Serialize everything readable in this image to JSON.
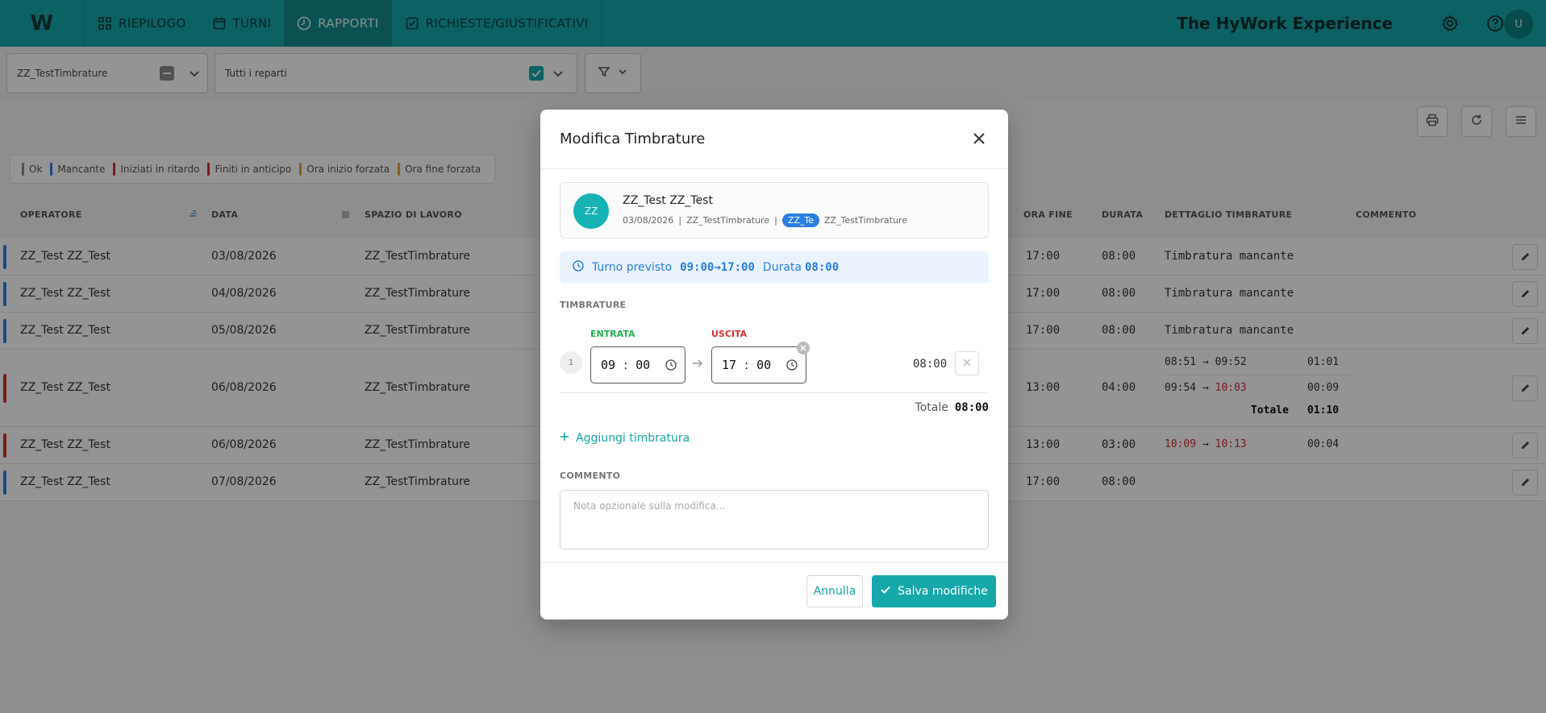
{
  "nav": {
    "logo": "W",
    "tabs": [
      {
        "label": "RIEPILOGO",
        "icon": "grid-icon"
      },
      {
        "label": "TURNI",
        "icon": "calendar-icon"
      },
      {
        "label": "RAPPORTI",
        "icon": "clock-icon",
        "active": true
      },
      {
        "label": "RICHIESTE/GIUSTIFICATIVI",
        "icon": "check-square-icon"
      }
    ],
    "brand": "The HyWork Experience",
    "user_initial": "U"
  },
  "filters": {
    "workspace": "ZZ_TestTimbrature",
    "department": "Tutti i reparti"
  },
  "legend": [
    "Ok",
    "Mancante",
    "Iniziati in ritardo",
    "Finiti in anticipo",
    "Ora inizio forzata",
    "Ora fine forzata"
  ],
  "legend_colors": [
    "#8a8d90",
    "#2a7de1",
    "#d62d2d",
    "#d62d2d",
    "#e6a23c",
    "#e6a23c"
  ],
  "table": {
    "headers": [
      "OPERATORE",
      "DATA",
      "SPAZIO DI LAVORO",
      "ORA FINE",
      "DURATA",
      "DETTAGLIO TIMBRATURE",
      "COMMENTO"
    ],
    "rows": [
      {
        "operator": "ZZ_Test ZZ_Test",
        "date": "03/08/2026",
        "space": "ZZ_TestTimbrature",
        "end": "17:00",
        "duration": "08:00",
        "detail": "Timbratura mancante"
      },
      {
        "operator": "ZZ_Test ZZ_Test",
        "date": "04/08/2026",
        "space": "ZZ_TestTimbrature",
        "end": "17:00",
        "duration": "08:00",
        "detail": "Timbratura mancante"
      },
      {
        "operator": "ZZ_Test ZZ_Test",
        "date": "05/08/2026",
        "space": "ZZ_TestTimbrature",
        "end": "17:00",
        "duration": "08:00",
        "detail": "Timbratura mancante"
      },
      {
        "operator": "ZZ_Test ZZ_Test",
        "date": "06/08/2026",
        "space": "ZZ_TestTimbrature",
        "end": "13:00",
        "duration": "04:00",
        "d1a": "08:51",
        "d1b": "09:52",
        "d1t": "01:01",
        "d2a": "09:54",
        "d2b": "10:03",
        "d2t": "00:09",
        "total_label": "Totale",
        "total": "01:10"
      },
      {
        "operator": "ZZ_Test ZZ_Test",
        "date": "06/08/2026",
        "space": "ZZ_TestTimbrature",
        "end": "13:00",
        "duration": "03:00",
        "d1a": "10:09",
        "d1b": "10:13",
        "d1t": "00:04"
      },
      {
        "operator": "ZZ_Test ZZ_Test",
        "date": "07/08/2026",
        "space": "ZZ_TestTimbrature",
        "end": "17:00",
        "duration": "08:00",
        "detail": ""
      }
    ],
    "arrow": "→"
  },
  "modal": {
    "title": "Modifica Timbrature",
    "employee": {
      "initials": "ZZ",
      "name": "ZZ_Test ZZ_Test",
      "date": "03/08/2026",
      "space": "ZZ_TestTimbrature",
      "badge": "ZZ_Te",
      "dept": "ZZ_TestTimbrature",
      "sep": "|"
    },
    "shift": {
      "label": "Turno previsto",
      "start": "09:00",
      "end": "17:00",
      "arrow": "→",
      "duration_label": "Durata",
      "duration": "08:00"
    },
    "stamps_label": "TIMBRATURE",
    "entry_label": "ENTRATA",
    "exit_label": "USCITA",
    "row_num": "1",
    "entry_h": "09",
    "entry_m": "00",
    "exit_h": "17",
    "exit_m": "00",
    "colon": ":",
    "row_duration": "08:00",
    "total_label": "Totale",
    "total": "08:00",
    "add_label": "Aggiungi timbratura",
    "comment_label": "COMMENTO",
    "comment_placeholder": "Nota opzionale sulla modifica...",
    "cancel": "Annulla",
    "save": "Salva modifiche"
  }
}
